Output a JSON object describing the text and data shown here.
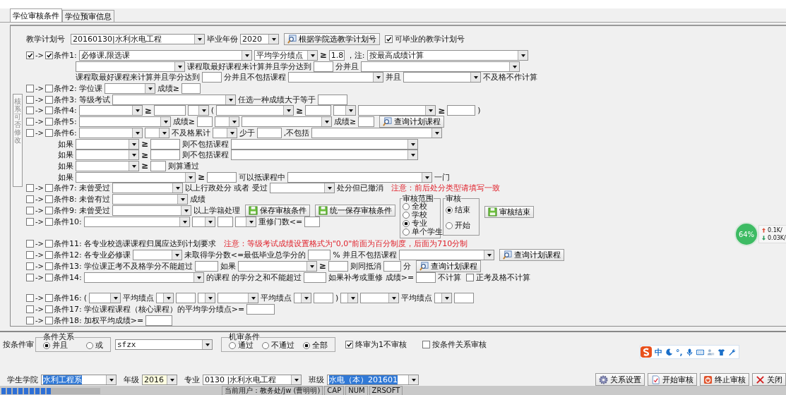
{
  "tabs": [
    {
      "label": "学位审核条件",
      "selected": true
    },
    {
      "label": "学位预审信息",
      "selected": false
    }
  ],
  "side_label": "核系可否修改",
  "conditions": [
    {
      "kind": "plain",
      "label": "教学计划号",
      "items": [
        {
          "kind": "combo",
          "value": "20160130|水利水电工程"
        },
        {
          "kind": "text",
          "text": "毕业年份"
        },
        {
          "kind": "combo",
          "value": "2020"
        },
        {
          "kind": "query_button",
          "label": "根据学院选教学计划号"
        },
        {
          "kind": "check",
          "label": "可毕业的教学计划号",
          "checked": true
        }
      ]
    },
    {
      "kind": "condition",
      "left_checked": true,
      "arrow": "->",
      "right_checked": true,
      "label": "条件1:",
      "items": [
        {
          "kind": "combo",
          "value": "必修课,限选课"
        },
        {
          "kind": "combo",
          "value": "平均学分绩点"
        },
        {
          "kind": "sign",
          "text": "≥"
        },
        {
          "kind": "input",
          "value": "1.8"
        },
        {
          "kind": "text",
          "text": "，注:"
        },
        {
          "kind": "combo",
          "value": "按最高成绩计算"
        }
      ]
    },
    {
      "kind": "sub",
      "items": [
        {
          "kind": "combo"
        },
        {
          "kind": "text",
          "text": "课程取最好课程来计算并且学分达到"
        },
        {
          "kind": "input"
        },
        {
          "kind": "text",
          "text": "分并且"
        },
        {
          "kind": "combo"
        }
      ]
    },
    {
      "kind": "sub",
      "items": [
        {
          "kind": "text",
          "text": "课程取最好课程来计算并且学分达到"
        },
        {
          "kind": "input"
        },
        {
          "kind": "text",
          "text": "分并且不包括课程"
        },
        {
          "kind": "combo"
        },
        {
          "kind": "text",
          "text": "并且"
        },
        {
          "kind": "combo"
        },
        {
          "kind": "text",
          "text": "不及格不作计算"
        }
      ]
    },
    {
      "kind": "condition",
      "left_checked": false,
      "arrow": "->",
      "right_checked": false,
      "label": "条件2:",
      "items": [
        {
          "kind": "text",
          "text": "学位课"
        },
        {
          "kind": "combo"
        },
        {
          "kind": "text",
          "text": "成绩≥"
        },
        {
          "kind": "input"
        }
      ]
    },
    {
      "kind": "condition",
      "left_checked": false,
      "arrow": "->",
      "right_checked": false,
      "label": "条件3:",
      "items": [
        {
          "kind": "text",
          "text": "等级考试"
        },
        {
          "kind": "combo"
        },
        {
          "kind": "text",
          "text": "任选一种成绩大于等于"
        },
        {
          "kind": "input"
        }
      ]
    },
    {
      "kind": "condition",
      "left_checked": false,
      "arrow": "->",
      "right_checked": false,
      "label": "条件4:",
      "items": [
        {
          "kind": "combo"
        },
        {
          "kind": "sign",
          "text": "≥"
        },
        {
          "kind": "input"
        },
        {
          "kind": "combo"
        },
        {
          "kind": "text",
          "text": "("
        },
        {
          "kind": "combo"
        },
        {
          "kind": "sign",
          "text": "≥"
        },
        {
          "kind": "input"
        },
        {
          "kind": "combo"
        },
        {
          "kind": "combo"
        },
        {
          "kind": "sign",
          "text": "≥"
        },
        {
          "kind": "input"
        },
        {
          "kind": "text",
          "text": ")"
        }
      ]
    },
    {
      "kind": "condition",
      "left_checked": false,
      "arrow": "->",
      "right_checked": false,
      "label": "条件5:",
      "items": [
        {
          "kind": "combo"
        },
        {
          "kind": "text",
          "text": "成绩≥"
        },
        {
          "kind": "input"
        },
        {
          "kind": "combo"
        },
        {
          "kind": "combo"
        },
        {
          "kind": "text",
          "text": "成绩≥"
        },
        {
          "kind": "input"
        },
        {
          "kind": "query_button",
          "label": "查询计划课程"
        }
      ]
    },
    {
      "kind": "condition",
      "left_checked": false,
      "arrow": "->",
      "right_checked": false,
      "label": "条件6:",
      "items": [
        {
          "kind": "combo"
        },
        {
          "kind": "combo"
        },
        {
          "kind": "text",
          "text": "不及格累计"
        },
        {
          "kind": "combo"
        },
        {
          "kind": "text",
          "text": "少于"
        },
        {
          "kind": "input"
        },
        {
          "kind": "text",
          "text": ",不包括"
        },
        {
          "kind": "combo"
        }
      ]
    },
    {
      "kind": "sub",
      "label": "如果",
      "items": [
        {
          "kind": "combo"
        },
        {
          "kind": "sign",
          "text": "≥"
        },
        {
          "kind": "input"
        },
        {
          "kind": "text",
          "text": "则不包括课程"
        },
        {
          "kind": "combo"
        }
      ]
    },
    {
      "kind": "sub",
      "label": "如果",
      "items": [
        {
          "kind": "combo"
        },
        {
          "kind": "sign",
          "text": "≥"
        },
        {
          "kind": "input"
        },
        {
          "kind": "text",
          "text": "则不包括课程"
        },
        {
          "kind": "combo"
        }
      ]
    },
    {
      "kind": "sub",
      "label": "如果",
      "items": [
        {
          "kind": "combo"
        },
        {
          "kind": "sign",
          "text": "≥"
        },
        {
          "kind": "input"
        },
        {
          "kind": "text",
          "text": "则算通过"
        }
      ]
    },
    {
      "kind": "sub",
      "label": "如果",
      "items": [
        {
          "kind": "combo"
        },
        {
          "kind": "sign",
          "text": "≥"
        },
        {
          "kind": "input"
        },
        {
          "kind": "text",
          "text": "可以抵课程中"
        },
        {
          "kind": "combo"
        },
        {
          "kind": "text",
          "text": "一门"
        }
      ]
    },
    {
      "kind": "condition",
      "left_checked": false,
      "arrow": "->",
      "right_checked": false,
      "label": "条件7:",
      "items": [
        {
          "kind": "text",
          "text": "未曾受过"
        },
        {
          "kind": "combo"
        },
        {
          "kind": "text",
          "text": "以上行政处分 或者 受过"
        },
        {
          "kind": "combo"
        },
        {
          "kind": "text",
          "text": "处分但已撤消"
        },
        {
          "kind": "note",
          "text": "注意：前后处分类型请填写一致"
        }
      ]
    },
    {
      "kind": "condition",
      "left_checked": false,
      "arrow": "->",
      "right_checked": false,
      "label": "条件8:",
      "items": [
        {
          "kind": "text",
          "text": "未曾有过"
        },
        {
          "kind": "combo"
        },
        {
          "kind": "text",
          "text": "成绩"
        }
      ]
    },
    {
      "kind": "condition",
      "left_checked": false,
      "arrow": "->",
      "right_checked": false,
      "label": "条件9:",
      "items": [
        {
          "kind": "text",
          "text": "未曾受过"
        },
        {
          "kind": "combo"
        },
        {
          "kind": "text",
          "text": "以上学籍处理"
        },
        {
          "kind": "save_button",
          "label": "保存审核条件"
        },
        {
          "kind": "save_button",
          "label": "统一保存审核条件"
        }
      ]
    },
    {
      "kind": "condition",
      "left_checked": false,
      "arrow": "->",
      "right_checked": false,
      "label": "条件10:",
      "items": [
        {
          "kind": "combo"
        },
        {
          "kind": "combo"
        },
        {
          "kind": "input"
        },
        {
          "kind": "combo"
        },
        {
          "kind": "text",
          "text": "重修门数<="
        },
        {
          "kind": "input"
        }
      ]
    },
    {
      "kind": "condition",
      "left_checked": false,
      "arrow": "->",
      "right_checked": false,
      "label": "条件11:",
      "items": [
        {
          "kind": "text",
          "text": "各专业校选课课程归属应达到计划要求"
        },
        {
          "kind": "note",
          "text": "注意：等级考试成绩设置格式为\"0,0\"前面为百分制度，后面为710分制"
        }
      ]
    },
    {
      "kind": "condition",
      "left_checked": false,
      "arrow": "->",
      "right_checked": false,
      "label": "条件12:",
      "items": [
        {
          "kind": "text",
          "text": "各专业必修课"
        },
        {
          "kind": "combo"
        },
        {
          "kind": "text",
          "text": "未取得学分数<=最低毕业总学分的"
        },
        {
          "kind": "input"
        },
        {
          "kind": "text",
          "text": "% 并且不包括课程"
        },
        {
          "kind": "combo"
        },
        {
          "kind": "query_button",
          "label": "查询计划课程"
        }
      ]
    },
    {
      "kind": "condition",
      "left_checked": false,
      "arrow": "->",
      "right_checked": false,
      "label": "条件13:",
      "items": [
        {
          "kind": "text",
          "text": "学位课正考不及格学分不能超过"
        },
        {
          "kind": "input"
        },
        {
          "kind": "text",
          "text": "如果"
        },
        {
          "kind": "combo"
        },
        {
          "kind": "sign",
          "text": "≥"
        },
        {
          "kind": "input"
        },
        {
          "kind": "text",
          "text": "则同抵消"
        },
        {
          "kind": "input"
        },
        {
          "kind": "text",
          "text": "分"
        },
        {
          "kind": "query_button",
          "label": "查询计划课程"
        }
      ]
    },
    {
      "kind": "condition",
      "left_checked": false,
      "arrow": "->",
      "right_checked": false,
      "label": "条件14:",
      "items": [
        {
          "kind": "combo"
        },
        {
          "kind": "text",
          "text": "的课程 的学分之和不能超过"
        },
        {
          "kind": "input"
        },
        {
          "kind": "text",
          "text": "如果补考或重修 成绩>="
        },
        {
          "kind": "input"
        },
        {
          "kind": "text",
          "text": "不计算"
        },
        {
          "kind": "check",
          "label": "正考及格不计算",
          "checked": false
        }
      ]
    },
    {
      "kind": "condition",
      "left_checked": false,
      "arrow": "->",
      "right_checked": false,
      "label": "条件16:",
      "items": [
        {
          "kind": "text",
          "text": "("
        },
        {
          "kind": "combo"
        },
        {
          "kind": "text",
          "text": "平均绩点"
        },
        {
          "kind": "combo"
        },
        {
          "kind": "input"
        },
        {
          "kind": "combo"
        },
        {
          "kind": "combo"
        },
        {
          "kind": "text",
          "text": "平均绩点"
        },
        {
          "kind": "combo"
        },
        {
          "kind": "input"
        },
        {
          "kind": "text",
          "text": ")"
        },
        {
          "kind": "combo"
        },
        {
          "kind": "combo"
        },
        {
          "kind": "text",
          "text": "平均绩点"
        },
        {
          "kind": "combo"
        },
        {
          "kind": "input"
        }
      ]
    },
    {
      "kind": "condition",
      "left_checked": false,
      "arrow": "->",
      "right_checked": false,
      "label": "条件17:",
      "items": [
        {
          "kind": "text",
          "text": "学位课程课程（核心课程）的平均学分绩点>="
        },
        {
          "kind": "input"
        }
      ]
    },
    {
      "kind": "condition",
      "left_checked": false,
      "arrow": "->",
      "right_checked": false,
      "label": "条件18:",
      "items": [
        {
          "kind": "text",
          "text": "加权平均成绩>="
        },
        {
          "kind": "input"
        }
      ]
    }
  ],
  "scope_group": {
    "title": "审核范围",
    "options": [
      {
        "label": "全校",
        "selected": false
      },
      {
        "label": "学校",
        "selected": false
      },
      {
        "label": "专业",
        "selected": true
      },
      {
        "label": "单个学生",
        "selected": false
      }
    ]
  },
  "review_group": {
    "title": "审核",
    "options": [
      {
        "label": "结束",
        "selected": true
      },
      {
        "label": "开始",
        "selected": false
      }
    ]
  },
  "finish_button": "审核结束",
  "bottom": {
    "filter_label": "按条件审",
    "relation_group": {
      "title": "条件关系",
      "options": [
        {
          "label": "并且",
          "selected": true
        },
        {
          "label": "或",
          "selected": false
        }
      ]
    },
    "relation_value": "sfzx",
    "machine_group": {
      "title": "机审条件",
      "options": [
        {
          "label": "通过",
          "selected": false
        },
        {
          "label": "不通过",
          "selected": false
        },
        {
          "label": "全部",
          "selected": true
        }
      ]
    },
    "checks": [
      {
        "label": "终审为1不审核",
        "checked": true
      },
      {
        "label": "按条件关系审核",
        "checked": false
      }
    ],
    "filters": [
      {
        "label": "学生学院",
        "value": "水利工程系",
        "highlighted": true,
        "focused": false
      },
      {
        "label": "年级",
        "value": "2016",
        "highlighted": false,
        "focused": true
      },
      {
        "label": "专业",
        "value": "0130  |水利水电工程",
        "highlighted": false,
        "focused": false
      },
      {
        "label": "班级",
        "value": "水电（本）201601",
        "highlighted": true,
        "focused": false
      }
    ],
    "buttons": [
      "关系设置",
      "开始审核",
      "终止审核",
      "关闭"
    ]
  },
  "status_bar": {
    "progress": {
      "level": 0.5
    },
    "user": "当前用户：教务处/jw (曹明明)",
    "cap": "CAP",
    "num": "NUM",
    "vendor": "ZRSOFT"
  },
  "network_meter": {
    "percent": "64%",
    "up": "0.1K/",
    "down": "0.03K/"
  },
  "ime_toolbar": {
    "mode": "中",
    "punct": "°,"
  }
}
